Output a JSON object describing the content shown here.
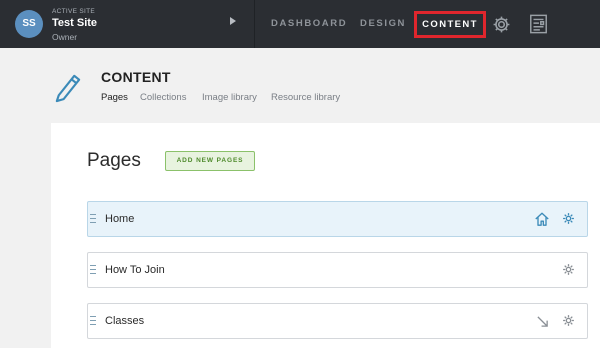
{
  "topbar": {
    "avatar_initials": "SS",
    "site_kicker": "ACTIVE SITE",
    "site_name": "Test Site",
    "site_role": "Owner",
    "nav": {
      "dashboard": "DASHBOARD",
      "design": "DESIGN",
      "content": "CONTENT"
    },
    "highlight_color": "#e0262d",
    "icons": [
      "triangle-right-icon",
      "gear-icon",
      "layout-icon"
    ]
  },
  "header": {
    "icon": "pencil-icon",
    "title": "CONTENT",
    "subnav": [
      "Pages",
      "Collections",
      "Image library",
      "Resource library"
    ],
    "active_subnav": "Pages"
  },
  "pages": {
    "title": "Pages",
    "add_button": "ADD NEW PAGES",
    "rows": [
      {
        "label": "Home",
        "icons": [
          "home-icon",
          "gear-icon"
        ],
        "highlighted": true
      },
      {
        "label": "How To Join",
        "icons": [
          "gear-icon"
        ],
        "highlighted": false
      },
      {
        "label": "Classes",
        "icons": [
          "arrow-down-right-icon",
          "gear-icon"
        ],
        "highlighted": false
      }
    ]
  },
  "colors": {
    "topbar": "#2b2e33",
    "accent_blue": "#3b8ab8",
    "add_button_green": "#4e8a2b"
  }
}
